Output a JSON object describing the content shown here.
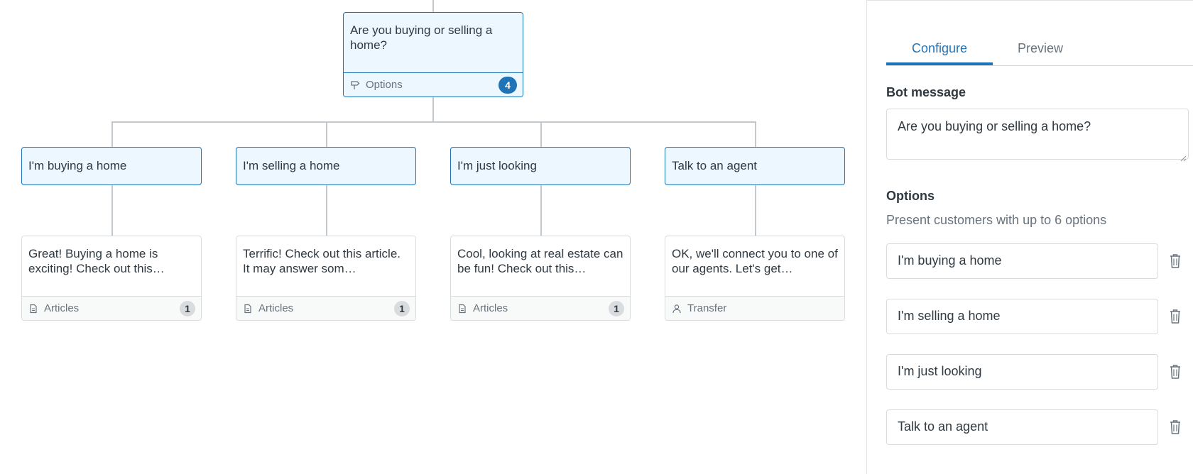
{
  "flow": {
    "question": {
      "text": "Are you buying or selling a home?",
      "footer_label": "Options",
      "footer_count": "4",
      "footer_icon": "signpost-icon"
    },
    "branches": [
      {
        "option": "I'm buying a home",
        "answer_text": "Great! Buying a home is exciting! Check out this…",
        "footer_label": "Articles",
        "footer_count": "1",
        "footer_icon": "article-icon"
      },
      {
        "option": "I'm selling a home",
        "answer_text": "Terrific! Check out this article. It may answer som…",
        "footer_label": "Articles",
        "footer_count": "1",
        "footer_icon": "article-icon"
      },
      {
        "option": "I'm just looking",
        "answer_text": "Cool, looking at real estate can be fun! Check out this…",
        "footer_label": "Articles",
        "footer_count": "1",
        "footer_icon": "article-icon"
      },
      {
        "option": "Talk to an agent",
        "answer_text": "OK, we'll connect you to one of our agents. Let's get…",
        "footer_label": "Transfer",
        "footer_count": "",
        "footer_icon": "person-icon"
      }
    ]
  },
  "panel": {
    "tabs": [
      "Configure",
      "Preview"
    ],
    "active_tab": "Configure",
    "bot_message_label": "Bot message",
    "bot_message_value": "Are you buying or selling a home?",
    "options_label": "Options",
    "options_hint": "Present customers with up to 6 options",
    "options": [
      "I'm buying a home",
      "I'm selling a home",
      "I'm just looking",
      "Talk to an agent"
    ]
  },
  "colors": {
    "accent": "#1f73b7",
    "selected_bg": "#edf7ff",
    "border": "#d8dcde",
    "connector": "#c2c8cc",
    "muted_text": "#68737d",
    "text": "#2f3941"
  }
}
